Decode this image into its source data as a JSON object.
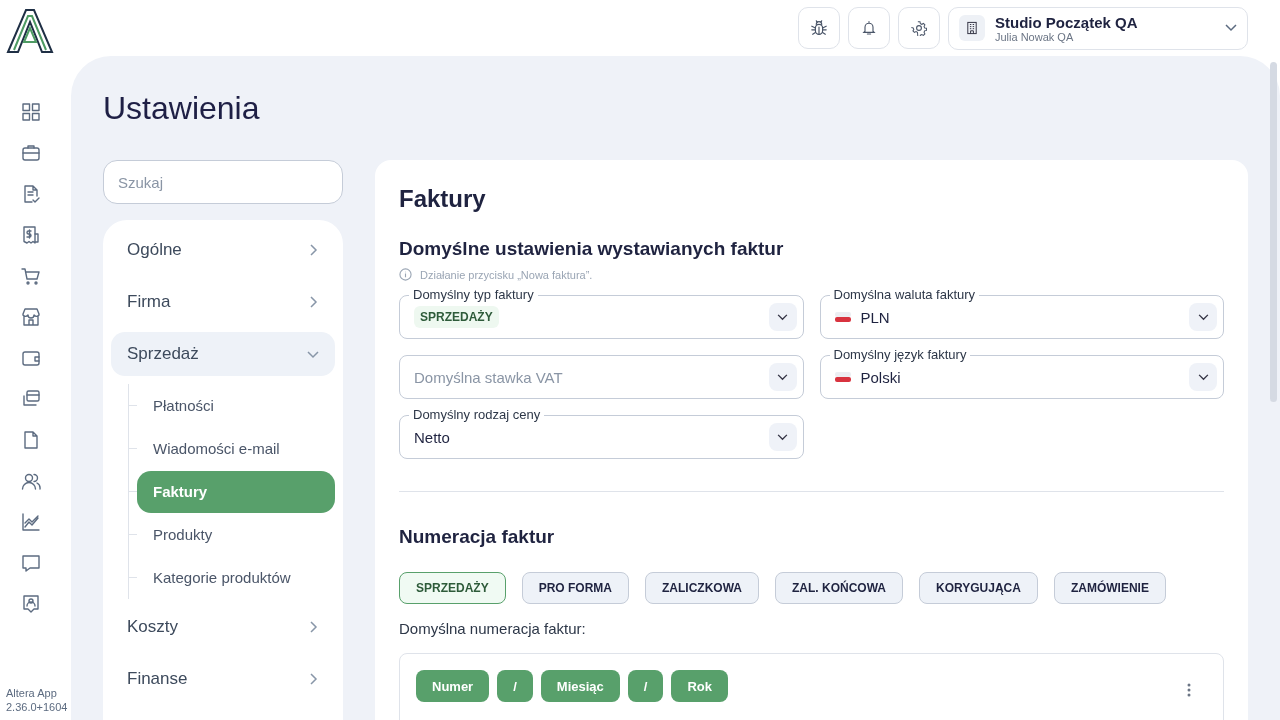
{
  "app": {
    "name": "Altera App",
    "version": "2.36.0+1604"
  },
  "topbar": {
    "company": "Studio Początek QA",
    "user": "Julia Nowak QA"
  },
  "page_title": "Ustawienia",
  "search": {
    "placeholder": "Szukaj"
  },
  "menu": [
    {
      "label": "Ogólne",
      "expanded": false
    },
    {
      "label": "Firma",
      "expanded": false
    },
    {
      "label": "Sprzedaż",
      "expanded": true,
      "children": [
        {
          "label": "Płatności",
          "selected": false
        },
        {
          "label": "Wiadomości e-mail",
          "selected": false
        },
        {
          "label": "Faktury",
          "selected": true
        },
        {
          "label": "Produkty",
          "selected": false
        },
        {
          "label": "Kategorie produktów",
          "selected": false
        }
      ]
    },
    {
      "label": "Koszty",
      "expanded": false
    },
    {
      "label": "Finanse",
      "expanded": false
    }
  ],
  "panel": {
    "title": "Faktury",
    "defaults": {
      "heading": "Domyślne ustawienia wystawianych faktur",
      "info": "Działanie przycisku „Nowa faktura”.",
      "fields": [
        {
          "kind": "chip",
          "label": "Domyślny typ faktury",
          "value": "SPRZEDAŻY"
        },
        {
          "kind": "empty",
          "placeholder": "Domyślna stawka VAT"
        },
        {
          "kind": "text",
          "label": "Domyślny rodzaj ceny",
          "value": "Netto"
        },
        {
          "kind": "flag",
          "label": "Domyślna waluta faktury",
          "value": "PLN"
        },
        {
          "kind": "flag",
          "label": "Domyślny język faktury",
          "value": "Polski"
        }
      ]
    },
    "numbering": {
      "heading": "Numeracja faktur",
      "tabs": [
        {
          "label": "SPRZEDAŻY",
          "selected": true
        },
        {
          "label": "PRO FORMA",
          "selected": false
        },
        {
          "label": "ZALICZKOWA",
          "selected": false
        },
        {
          "label": "ZAL. KOŃCOWA",
          "selected": false
        },
        {
          "label": "KORYGUJĄCA",
          "selected": false
        },
        {
          "label": "ZAMÓWIENIE",
          "selected": false
        }
      ],
      "label": "Domyślna numeracja faktur:",
      "tokens": [
        "Numer",
        "/",
        "Miesiąc",
        "/",
        "Rok"
      ]
    }
  }
}
